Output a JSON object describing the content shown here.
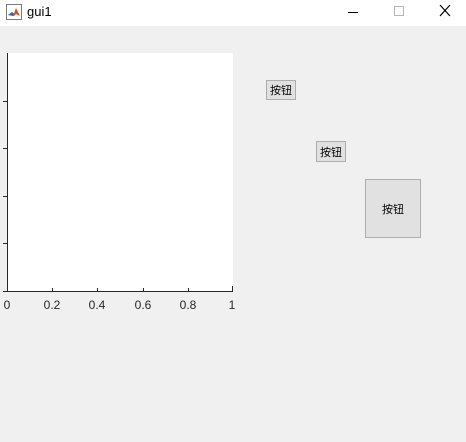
{
  "window": {
    "title": "gui1",
    "app_icon": "matlab-icon",
    "controls": [
      "minimize-icon",
      "maximize-icon",
      "close-icon"
    ]
  },
  "axes": {
    "x_tick_labels": [
      "0",
      "0.2",
      "0.4",
      "0.6",
      "0.8",
      "1"
    ],
    "xlim": [
      0,
      1
    ],
    "y_tick_count": 6
  },
  "buttons": {
    "button1_label": "按钮",
    "button2_label": "按钮",
    "button3_label": "按钮"
  },
  "colors": {
    "background": "#f0f0f0",
    "axes_background": "#ffffff",
    "button_face": "#e1e1e1"
  }
}
